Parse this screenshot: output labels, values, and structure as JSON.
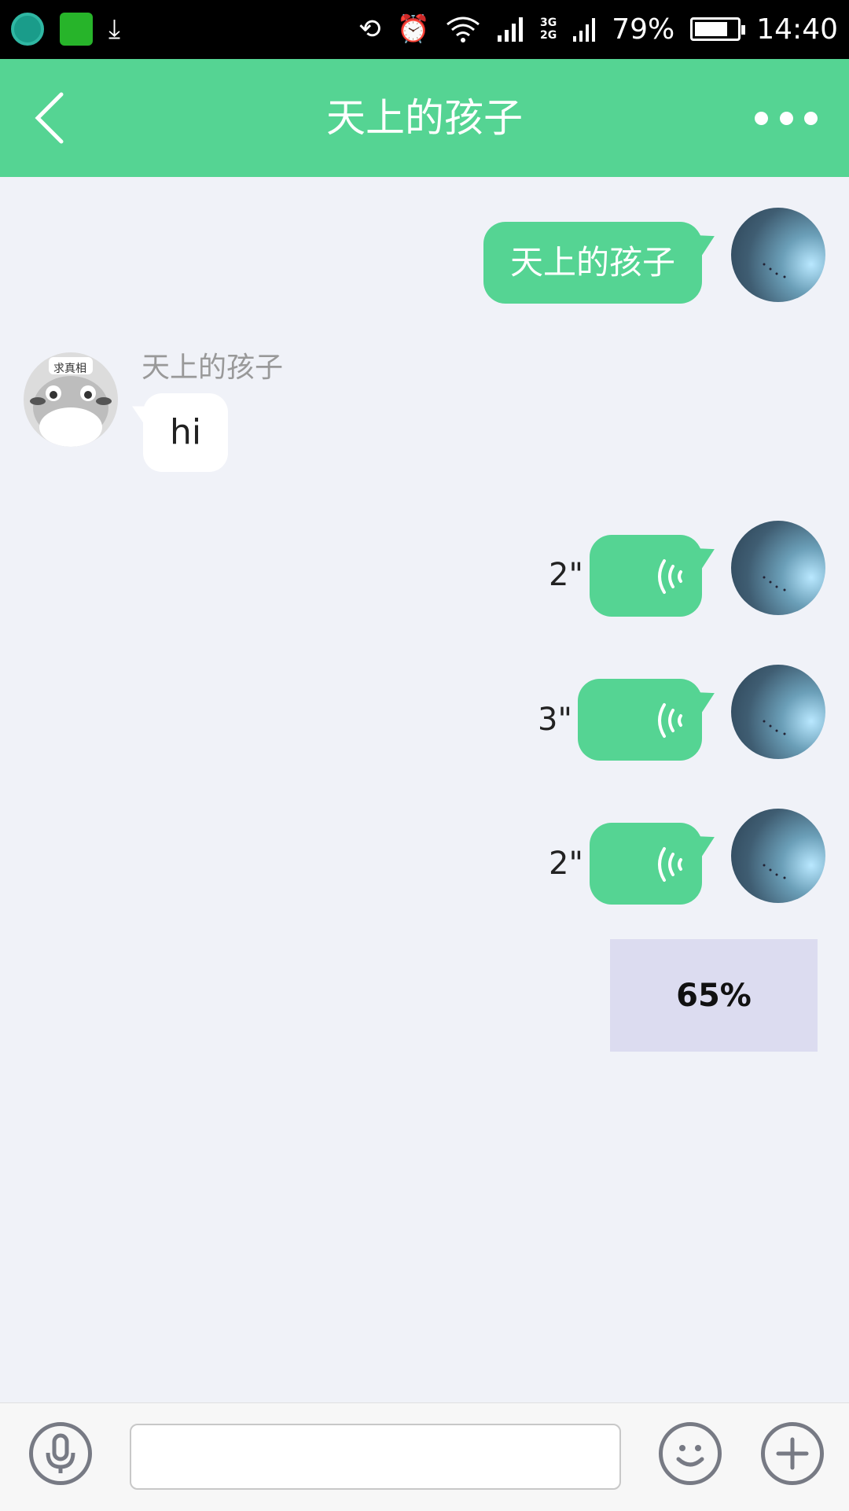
{
  "status_bar": {
    "battery": "79%",
    "battery_level": 0.79,
    "time": "14:40",
    "network_top": "3G",
    "network_bottom": "2G",
    "icons": [
      "app-icon",
      "wechat-icon",
      "download-icon",
      "rotate-icon",
      "alarm-icon",
      "wifi-icon",
      "signal-icon",
      "battery-icon"
    ]
  },
  "header": {
    "title": "天上的孩子",
    "back_icon": "chevron-left-icon",
    "more_icon": "more-dots-icon",
    "color": "#55d493"
  },
  "messages": [
    {
      "direction": "outgoing",
      "type": "text",
      "text": "天上的孩子"
    },
    {
      "direction": "incoming",
      "type": "text",
      "sender": "天上的孩子",
      "text": "hi",
      "avatar_label": "求真相"
    },
    {
      "direction": "outgoing",
      "type": "voice",
      "duration": "2\""
    },
    {
      "direction": "outgoing",
      "type": "voice",
      "duration": "3\""
    },
    {
      "direction": "outgoing",
      "type": "voice",
      "duration": "2\""
    },
    {
      "direction": "outgoing",
      "type": "upload",
      "progress": "65%"
    }
  ],
  "input_bar": {
    "mic_icon": "microphone-icon",
    "emoji_icon": "smiley-icon",
    "add_icon": "plus-icon",
    "text_value": ""
  },
  "colors": {
    "accent": "#55d493",
    "background": "#f0f2f8",
    "upload_box": "#dcdcf0"
  }
}
